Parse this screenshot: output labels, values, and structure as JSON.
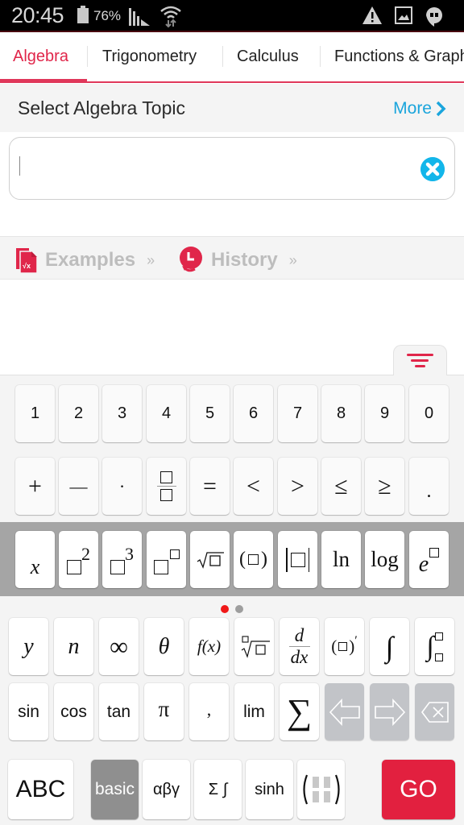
{
  "status_bar": {
    "time": "20:45",
    "battery_percent": "76%",
    "battery_level": 0.76,
    "icons": [
      "battery-icon",
      "signal-icon",
      "wifi-icon",
      "warning-icon",
      "image-icon",
      "hangouts-icon"
    ]
  },
  "tabs": [
    {
      "label": "Algebra",
      "active": true
    },
    {
      "label": "Trigonometry",
      "active": false
    },
    {
      "label": "Calculus",
      "active": false
    },
    {
      "label": "Functions & Graphs",
      "active": false
    }
  ],
  "topic": {
    "title": "Select Algebra Topic",
    "more_label": "More"
  },
  "input": {
    "value": "",
    "clear_icon": "clear-icon"
  },
  "links": {
    "examples_label": "Examples",
    "history_label": "History",
    "raquo": "»"
  },
  "colors": {
    "accent": "#e0264a",
    "link": "#1aa5dc",
    "clear": "#13b6ea",
    "go": "#e2203f"
  },
  "keyboard": {
    "row1": [
      "1",
      "2",
      "3",
      "4",
      "5",
      "6",
      "7",
      "8",
      "9",
      "0"
    ],
    "row2": [
      "+",
      "—",
      "·",
      "fraction",
      "=",
      "<",
      ">",
      "≤",
      "≥",
      "."
    ],
    "row3": [
      "x",
      "square",
      "cube",
      "power",
      "sqrt",
      "parens",
      "abs",
      "ln",
      "log",
      "exp"
    ],
    "row3_labels": {
      "ln": "ln",
      "log": "log",
      "x": "x",
      "e": "e",
      "two": "2",
      "three": "3"
    },
    "page_indicator": {
      "pages": 2,
      "current": 1
    },
    "row4": [
      "y",
      "n",
      "∞",
      "θ",
      "f(x)",
      "nth-root",
      "d/dx",
      "derivative",
      "∫",
      "definite-integral"
    ],
    "row4_labels": {
      "y": "y",
      "n": "n",
      "inf": "∞",
      "theta": "θ",
      "fx": "f(x)",
      "d": "d",
      "dx": "dx",
      "prime": "′",
      "int": "∫"
    },
    "row5": {
      "sin": "sin",
      "cos": "cos",
      "tan": "tan",
      "pi": "π",
      "comma": ",",
      "lim": "lim",
      "sum": "∑"
    },
    "bottom": {
      "abc": "ABC",
      "basic": "basic",
      "greek": "αβγ",
      "sigma_int": "Σ ∫",
      "sinh": "sinh",
      "go": "GO"
    }
  }
}
